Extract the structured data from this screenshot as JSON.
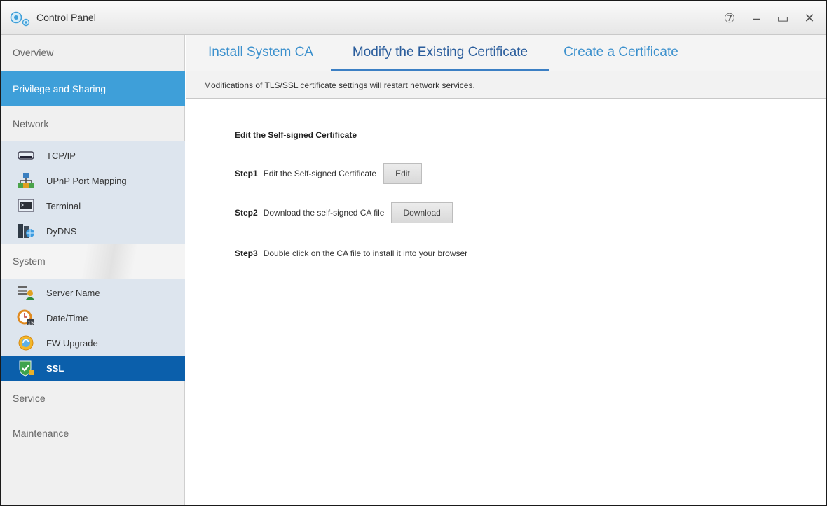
{
  "window": {
    "title": "Control Panel",
    "controls": {
      "help_glyph": "⑦",
      "minimize_glyph": "–",
      "maximize_glyph": "▭",
      "close_glyph": "✕"
    }
  },
  "sidebar": {
    "overview": "Overview",
    "privilege": "Privilege and Sharing",
    "network": "Network",
    "network_items": [
      {
        "label": "TCP/IP",
        "icon": "network-card-icon"
      },
      {
        "label": "UPnP Port Mapping",
        "icon": "upnp-network-icon"
      },
      {
        "label": "Terminal",
        "icon": "terminal-icon"
      },
      {
        "label": "DyDNS",
        "icon": "dydns-icon"
      }
    ],
    "system": "System",
    "system_items": [
      {
        "label": "Server Name",
        "icon": "server-name-icon"
      },
      {
        "label": "Date/Time",
        "icon": "date-time-icon"
      },
      {
        "label": "FW Upgrade",
        "icon": "fw-upgrade-icon"
      },
      {
        "label": "SSL",
        "icon": "ssl-shield-icon"
      }
    ],
    "service": "Service",
    "maintenance": "Maintenance"
  },
  "tabs": [
    {
      "label": "Install System CA"
    },
    {
      "label": "Modify the Existing Certificate"
    },
    {
      "label": "Create a Certificate"
    }
  ],
  "notice": "Modifications of TLS/SSL certificate settings will restart network services.",
  "content": {
    "section_title": "Edit the Self-signed Certificate",
    "steps": [
      {
        "label": "Step1",
        "text": "Edit the Self-signed Certificate",
        "button": "Edit"
      },
      {
        "label": "Step2",
        "text": "Download the self-signed CA file",
        "button": "Download"
      },
      {
        "label": "Step3",
        "text": "Double click on the CA file to install it into your browser"
      }
    ]
  },
  "colors": {
    "accent_blue": "#3e9fd9",
    "selected_blue": "#0b5fab",
    "tab_blue": "#3b90cd",
    "group_bg": "#dde5ee"
  }
}
